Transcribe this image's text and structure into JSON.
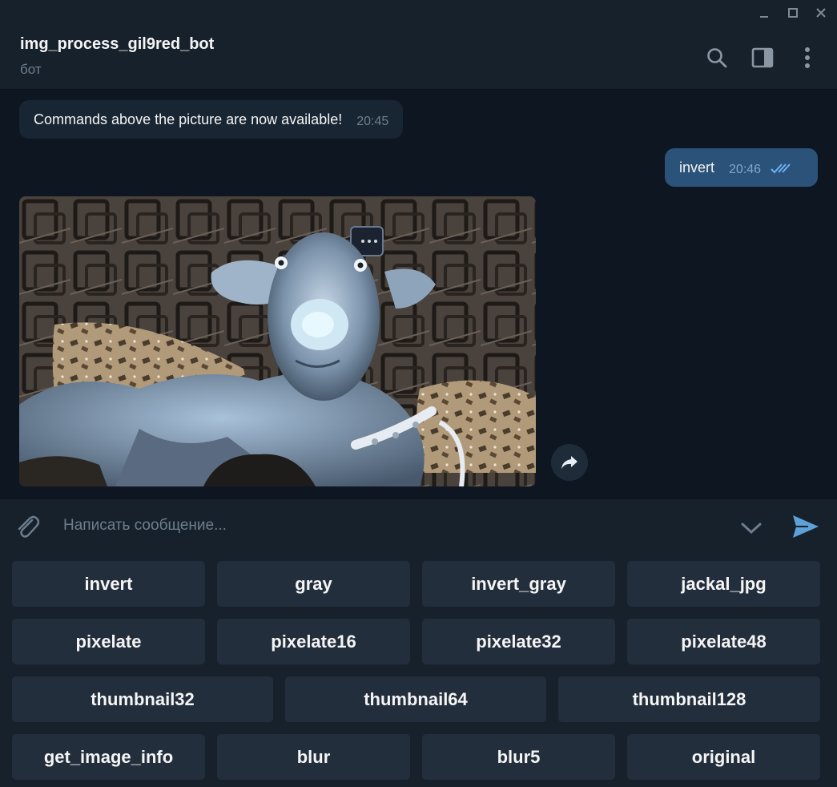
{
  "window": {
    "minimize_icon": "minimize-icon",
    "maximize_icon": "maximize-icon",
    "close_icon": "close-icon"
  },
  "header": {
    "title": "img_process_gil9red_bot",
    "subtitle": "бот",
    "icons": [
      "search-icon",
      "side-panel-icon",
      "more-vertical-icon"
    ]
  },
  "messages": [
    {
      "direction": "incoming",
      "text": "Commands above the picture are now available!",
      "time": "20:45"
    },
    {
      "direction": "outgoing",
      "text": "invert",
      "time": "20:46",
      "status": "read"
    },
    {
      "direction": "incoming",
      "type": "photo"
    }
  ],
  "composer": {
    "placeholder": "Написать сообщение...",
    "value": ""
  },
  "keyboard": {
    "rows": [
      [
        "invert",
        "gray",
        "invert_gray",
        "jackal_jpg"
      ],
      [
        "pixelate",
        "pixelate16",
        "pixelate32",
        "pixelate48"
      ],
      [
        "thumbnail32",
        "thumbnail64",
        "thumbnail128"
      ],
      [
        "get_image_info",
        "blur",
        "blur5",
        "original"
      ]
    ]
  },
  "colors": {
    "background": "#0e1621",
    "panel": "#17212b",
    "bubble_in": "#182533",
    "bubble_out": "#2b5278",
    "accent": "#5ea1d8",
    "keyboard_button": "#232e3c"
  }
}
